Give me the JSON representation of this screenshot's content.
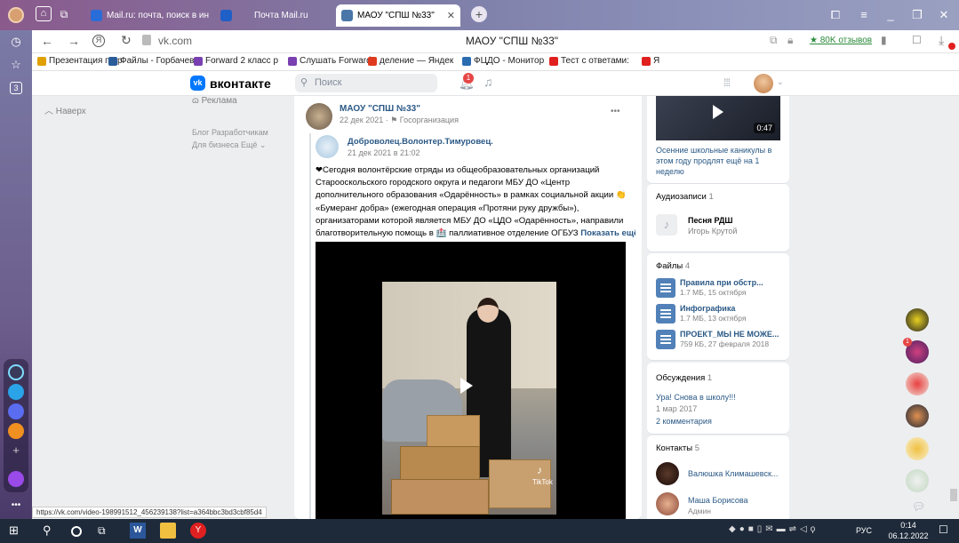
{
  "browser": {
    "tabs": [
      {
        "label": "Mail.ru: почта, поиск в ин"
      },
      {
        "label": "Почта Mail.ru"
      },
      {
        "label": "МАОУ \"СПШ №33\""
      }
    ],
    "address": "vk.com",
    "page_title": "МАОУ \"СПШ №33\"",
    "reviews": "★ 80K отзывов",
    "status_url": "https://vk.com/video-198991512_456239138?list=a364bbc3bd3cbf85d4",
    "side_badge": "3"
  },
  "bookmarks": [
    {
      "label": "Презентация по р",
      "color": "#e0a000"
    },
    {
      "label": "Файлы - Горбачев",
      "color": "#2a5c9a"
    },
    {
      "label": "Forward 2 класс р",
      "color": "#7a3fb0"
    },
    {
      "label": "Слушать Forward",
      "color": "#7a3fb0"
    },
    {
      "label": "деление — Яндек",
      "color": "#e03a1e"
    },
    {
      "label": "ФЦДО - Монитор",
      "color": "#2a6cb0"
    },
    {
      "label": "Тест с ответами:",
      "color": "#e0201e"
    },
    {
      "label": "Я",
      "color": "#e0201e"
    }
  ],
  "vk": {
    "logo": "вконтакте",
    "search_placeholder": "Поиск",
    "notif_count": "1"
  },
  "left": {
    "back": "Наверх",
    "ads": "Реклама",
    "links1": "Блог  Разработчикам",
    "links2": "Для бизнеса  Ещё ⌄"
  },
  "post": {
    "author": "МАОУ \"СПШ №33\"",
    "date": "22 дек 2021 · ⚑ Госорганизация",
    "repost_author": "Доброволец.Волонтер.Тимуровец.",
    "repost_date": "21 дек 2021 в 21:02",
    "text_lines": [
      "❤Сегодня волонтёрские отряды из общеобразовательных организаций",
      "Старооскольского городского округа и педагоги МБУ ДО «Центр",
      "дополнительного образования «Одарённость» в рамках социальной акции 👏",
      "«Бумеранг добра» (ежегодная операция «Протяни руку дружбы»),",
      "организаторами которой является МБУ ДО «ЦДО «Одарённость», направили",
      "благотворительную помощь в 🏥 паллиативное отделение ОГБУЗ"
    ],
    "show_more": "Показать ещё",
    "tiktok": "TikTok"
  },
  "right": {
    "video_caption": "Осенние школьные каникулы в этом году продлят ещё на 1 неделю",
    "video_duration": "0:47",
    "audio_title": "Аудиозаписи",
    "audio_count": "1",
    "audio_song": "Песня РДШ",
    "audio_artist": "Игорь Крутой",
    "files_title": "Файлы",
    "files_count": "4",
    "files": [
      {
        "name": "Правила при обстр...",
        "meta": "1.7 МБ, 15 октября"
      },
      {
        "name": "Инфографика",
        "meta": "1.7 МБ, 13 октября"
      },
      {
        "name": "ПРОЕКТ_МЫ НЕ МОЖЕ...",
        "meta": "759 КБ, 27 февраля 2018"
      }
    ],
    "discussions_title": "Обсуждения",
    "discussions_count": "1",
    "discussion_topic": "Ура! Снова в школу!!!",
    "discussion_date": "1 мар 2017",
    "discussion_comments": "2 комментария",
    "contacts_title": "Контакты",
    "contacts_count": "5",
    "contacts": [
      {
        "name": "Валюшка Климашевск...",
        "role": ""
      },
      {
        "name": "Маша Борисова",
        "role": "Админ"
      }
    ]
  },
  "taskbar": {
    "lang": "РУС",
    "time": "0:14",
    "date": "06.12.2022"
  },
  "colors": {
    "vk_blue": "#2a5885",
    "accent": "#5181b8",
    "taskbar": "#1e2a3a"
  }
}
